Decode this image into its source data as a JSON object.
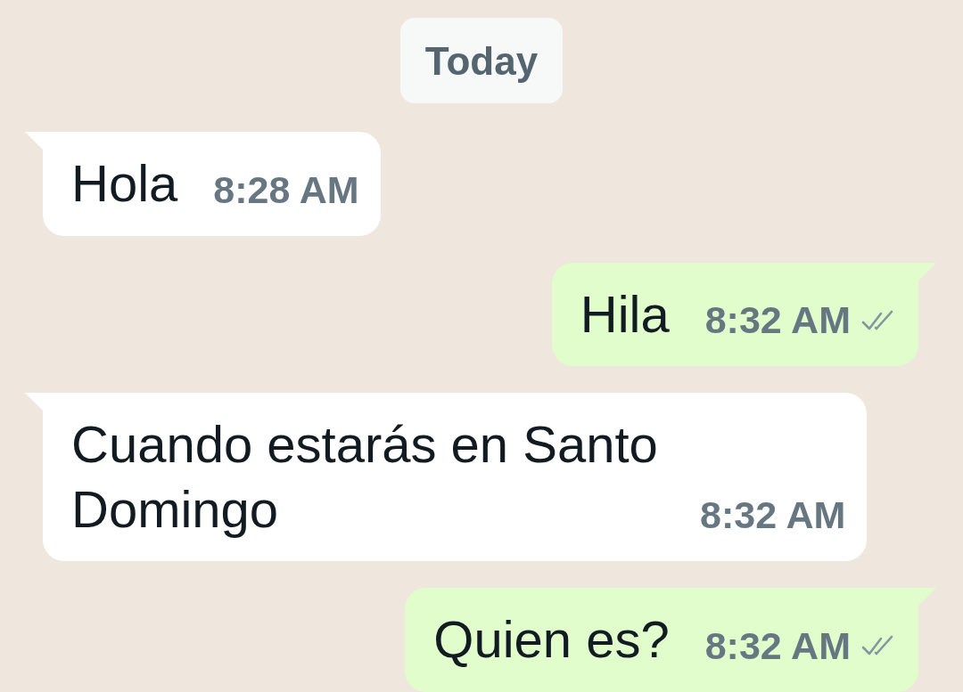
{
  "date_divider": "Today",
  "messages": [
    {
      "outgoing": false,
      "text": "Hola",
      "time": "8:28 AM"
    },
    {
      "outgoing": true,
      "text": "Hila",
      "time": "8:32 AM",
      "read": false
    },
    {
      "outgoing": false,
      "text": "Cuando estarás en Santo Domingo",
      "time": "8:32 AM"
    },
    {
      "outgoing": true,
      "text": "Quien es?",
      "time": "8:32 AM",
      "read": false
    }
  ]
}
